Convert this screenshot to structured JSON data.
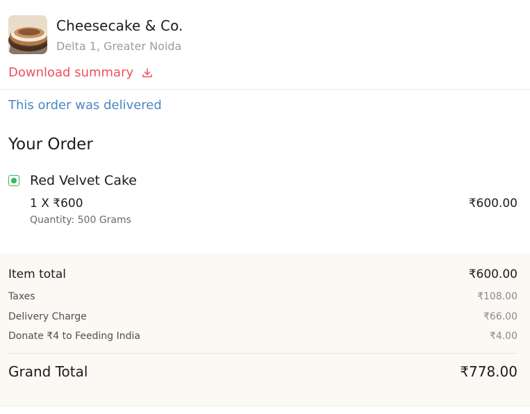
{
  "restaurant": {
    "name": "Cheesecake & Co.",
    "location": "Delta 1, Greater Noida",
    "image_icon": "cheesecake-photo"
  },
  "download": {
    "label": "Download summary",
    "icon": "download-icon",
    "color": "#ef4f5f"
  },
  "status": {
    "text": "This order was delivered",
    "color": "#4a86c7"
  },
  "order": {
    "heading": "Your Order",
    "items": [
      {
        "name": "Red Velvet Cake",
        "quantity_line": "1 X ₹600",
        "price": "₹600.00",
        "note": "Quantity: 500 Grams",
        "veg_icon": "veg-indicator-icon",
        "veg_color": "#3ab757"
      }
    ]
  },
  "bill": {
    "item_total_label": "Item total",
    "item_total_value": "₹600.00",
    "taxes_label": "Taxes",
    "taxes_value": "₹108.00",
    "delivery_label": "Delivery Charge",
    "delivery_value": "₹66.00",
    "donate_label": "Donate ₹4 to Feeding India",
    "donate_value": "₹4.00",
    "grand_total_label": "Grand Total",
    "grand_total_value": "₹778.00",
    "background": "#fcf8f4"
  }
}
